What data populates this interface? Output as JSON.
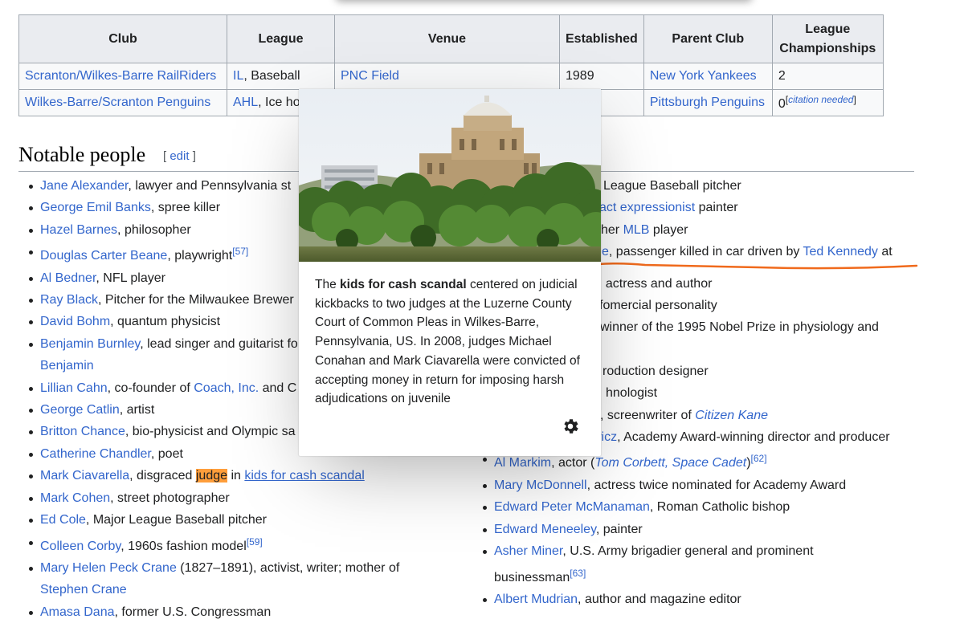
{
  "table": {
    "headers": [
      "Club",
      "League",
      "Venue",
      "Established",
      "Parent Club",
      "League Championships"
    ],
    "rows": [
      {
        "club": "Scranton/Wilkes-Barre RailRiders",
        "league_link": "IL",
        "league_rest": ", Baseball",
        "venue": "PNC Field",
        "established": "1989",
        "parent": "New York Yankees",
        "championships": "2"
      },
      {
        "club": "Wilkes-Barre/Scranton Penguins",
        "league_link": "AHL",
        "league_rest": ", Ice ho",
        "venue": "",
        "established": "",
        "parent": "Pittsburgh Penguins",
        "championships": "0",
        "citation": "citation needed"
      }
    ]
  },
  "section": {
    "title": "Notable people",
    "edit_open": "[ ",
    "edit_label": "edit",
    "edit_close": " ]"
  },
  "left_list": [
    {
      "name": "Jane Alexander",
      "desc": ", lawyer and Pennsylvania st"
    },
    {
      "name": "George Emil Banks",
      "desc": ", spree killer"
    },
    {
      "name": "Hazel Barnes",
      "desc": ", philosopher"
    },
    {
      "name": "Douglas Carter Beane",
      "desc": ", playwright",
      "ref": "[57]"
    },
    {
      "name": "Al Bedner",
      "desc": ", NFL player"
    },
    {
      "name": "Ray Black",
      "desc": ", Pitcher for the Milwaukee Brewer"
    },
    {
      "name": "David Bohm",
      "desc": ", quantum physicist"
    },
    {
      "name": "Benjamin Burnley",
      "desc": ", lead singer and guitarist fo",
      "cont": "Benjamin"
    },
    {
      "name": "Lillian Cahn",
      "desc": ", co-founder of ",
      "link2": "Coach, Inc.",
      "desc2": " and C"
    },
    {
      "name": "George Catlin",
      "desc": ", artist"
    },
    {
      "name": "Britton Chance",
      "desc": ", bio-physicist and Olympic sa"
    },
    {
      "name": "Catherine Chandler",
      "desc": ", poet"
    },
    {
      "name": "Mark Ciavarella",
      "desc": ", disgraced ",
      "highlight": "judge",
      "desc2": " in ",
      "link2": "kids for cash scandal"
    },
    {
      "name": "Mark Cohen",
      "desc": ", street photographer"
    },
    {
      "name": "Ed Cole",
      "desc": ", Major League Baseball pitcher"
    },
    {
      "name": "Colleen Corby",
      "desc": ", 1960s fashion model",
      "ref": "[59]"
    },
    {
      "name": "Mary Helen Peck Crane",
      "desc": " (1827–1891), activist, writer; mother of",
      "cont": "Stephen Crane"
    },
    {
      "name": "Amasa Dana",
      "desc": ", former U.S. Congressman"
    }
  ],
  "right_list": {
    "partial1": "League Baseball pitcher",
    "partial2_link": "act expressionist",
    "partial2_rest": " painter",
    "partial3_pre": "her ",
    "partial3_link": "MLB",
    "partial3_rest": " player",
    "partial4_link": "e",
    "partial4_text": ", passenger killed in car driven by ",
    "partial4_link2": "Ted Kennedy",
    "partial4_rest": " at",
    "partial5_link": "k",
    "partial5_rest": ", actress and author",
    "partial6": "fomercial personality",
    "partial7": "winner of the 1995 Nobel Prize in physiology and",
    "partial8": "roduction designer",
    "partial9": "hnologist",
    "partial10_link": "cz",
    "partial10_rest": ", screenwriter of ",
    "partial10_italic": "Citizen Kane",
    "partial11_link": "wicz",
    "partial11_rest": ", Academy Award-winning director and producer",
    "full": [
      {
        "name": "Al Markim",
        "desc": ", actor (",
        "italic_link": "Tom Corbett, Space Cadet",
        "desc2": ")",
        "ref": "[62]"
      },
      {
        "name": "Mary McDonnell",
        "desc": ", actress twice nominated for Academy Award"
      },
      {
        "name": "Edward Peter McManaman",
        "desc": ", Roman Catholic bishop"
      },
      {
        "name": "Edward Meneeley",
        "desc": ", painter"
      },
      {
        "name": "Asher Miner",
        "desc": ", U.S. Army brigadier general and prominent",
        "cont": "businessman",
        "ref": "[63]"
      },
      {
        "name": "Albert Mudrian",
        "desc": ", author and magazine editor"
      }
    ]
  },
  "popup": {
    "lead": "The ",
    "bold": "kids for cash scandal",
    "text": " centered on judicial kickbacks to two judges at the Luzerne County Court of Common Pleas in Wilkes-Barre, Pennsylvania, US. In 2008, judges Michael Conahan and Mark Ciavarella were convicted of accepting money in return for imposing harsh adjudications on juvenile",
    "settings_icon": "gear-icon"
  },
  "colors": {
    "link": "#3366cc",
    "highlight": "#ff9e3b",
    "annotation": "#f06a1c",
    "table_header": "#eaecf0",
    "table_cell": "#f8f9fa"
  }
}
